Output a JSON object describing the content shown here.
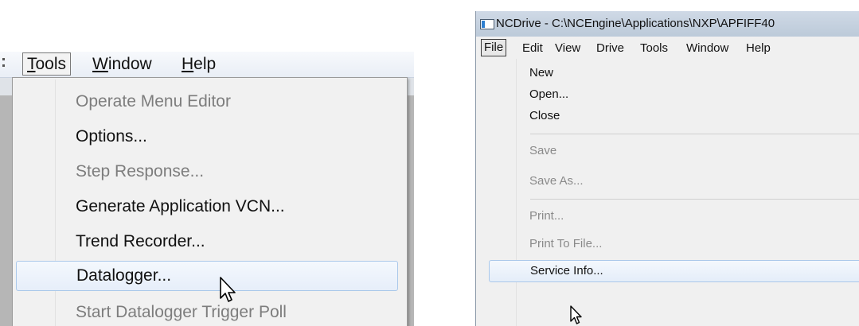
{
  "left": {
    "menubar": {
      "tools": "Tools",
      "window": "Window",
      "help": "Help"
    },
    "menu": [
      {
        "label": "Operate Menu Editor",
        "enabled": false
      },
      {
        "label": "Options...",
        "enabled": true
      },
      {
        "label": "Step Response...",
        "enabled": false
      },
      {
        "label": "Generate Application VCN...",
        "enabled": true
      },
      {
        "label": "Trend Recorder...",
        "enabled": true
      },
      {
        "label": "Datalogger...",
        "enabled": true,
        "highlighted": true
      },
      {
        "label": "Start Datalogger Trigger Poll",
        "enabled": false
      }
    ]
  },
  "right": {
    "title": "NCDrive - C:\\NCEngine\\Applications\\NXP\\APFIFF40",
    "menubar": [
      "File",
      "Edit",
      "View",
      "Drive",
      "Tools",
      "Window",
      "Help"
    ],
    "menu": [
      {
        "label": "New",
        "enabled": true
      },
      {
        "label": "Open...",
        "enabled": true
      },
      {
        "label": "Close",
        "enabled": true
      },
      {
        "label": "Save",
        "enabled": false
      },
      {
        "label": "Save As...",
        "enabled": false
      },
      {
        "label": "Print...",
        "enabled": false
      },
      {
        "label": "Print To File...",
        "enabled": false
      },
      {
        "label": "Service Info...",
        "enabled": true,
        "highlighted": true
      }
    ]
  }
}
